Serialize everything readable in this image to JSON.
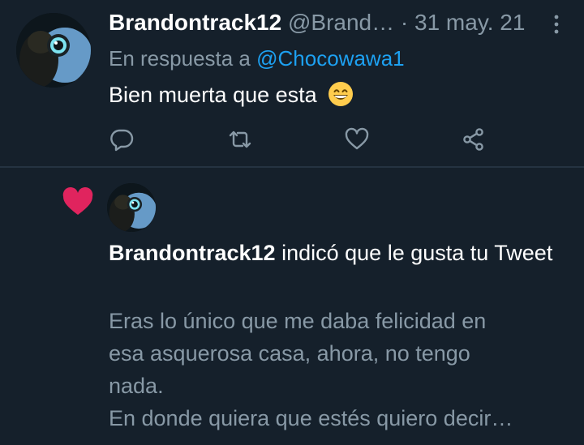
{
  "tweet": {
    "display_name": "Brandontrack12",
    "handle": "@Brand…",
    "separator": "·",
    "date": "31 may. 21",
    "reply_prefix": "En respuesta a",
    "reply_handle": "@Chocowawa1",
    "text": "Bien muerta que esta",
    "emoji": "grinning-face-with-smiling-eyes",
    "actions": [
      "reply-icon",
      "retweet-icon",
      "like-icon",
      "share-icon"
    ]
  },
  "notification": {
    "icon": "heart-icon",
    "name": "Brandontrack12",
    "action_text": "indicó que le gusta tu Tweet",
    "quoted_lines": [
      "Eras lo único que me daba felicidad en",
      "esa asquerosa casa, ahora, no tengo",
      "nada.",
      "En donde quiera que estés quiero decir…"
    ]
  },
  "colors": {
    "background": "#15202b",
    "secondary_text": "#8899a6",
    "link": "#1da1f2",
    "like": "#e0245e",
    "divider": "#253341"
  }
}
